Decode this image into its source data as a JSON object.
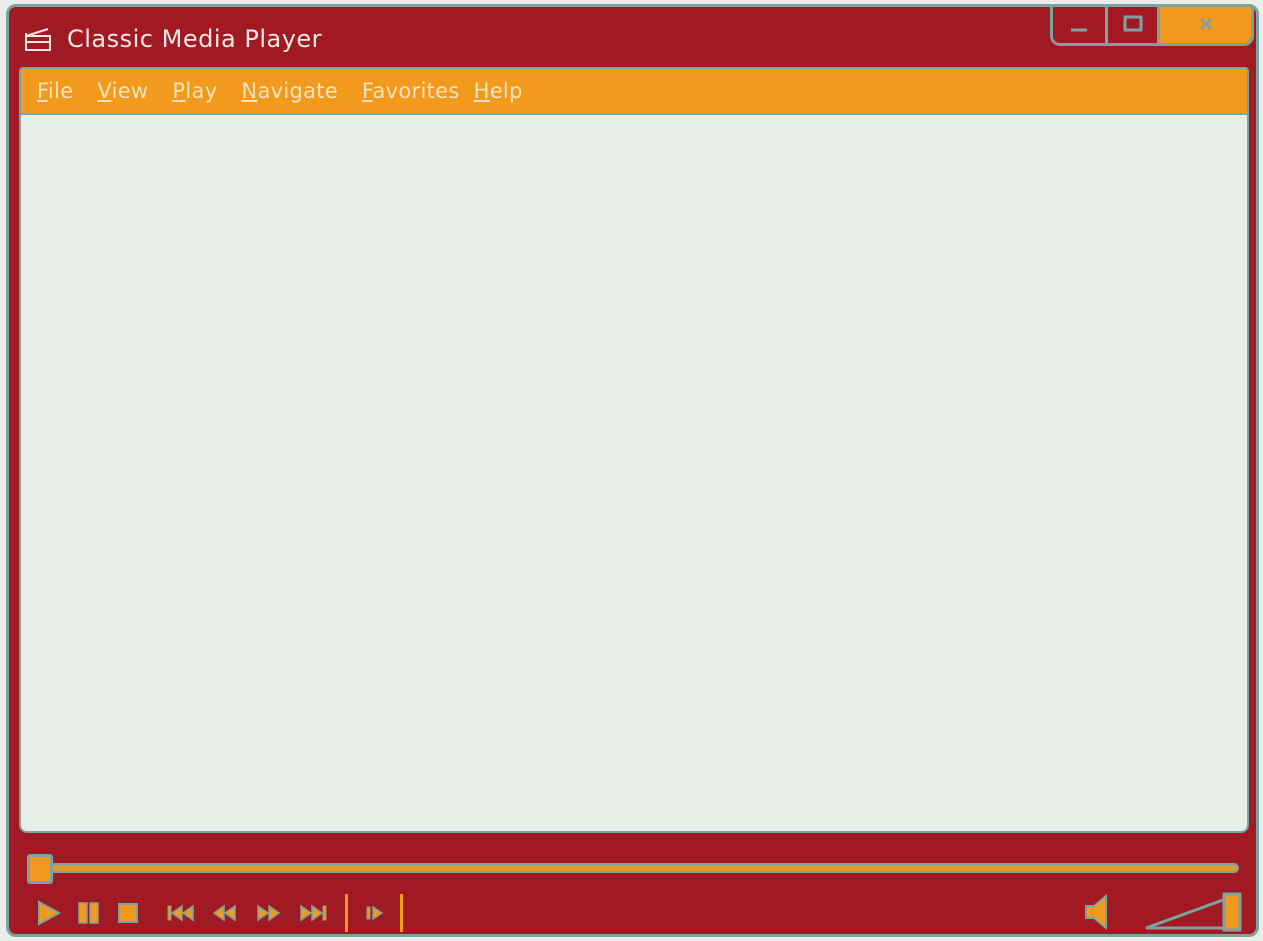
{
  "window": {
    "title": "Classic Media Player",
    "icon": "clapperboard-icon",
    "controls": {
      "minimize": "minimize-icon",
      "maximize": "maximize-icon",
      "close": "close-icon"
    }
  },
  "menu": {
    "items": [
      {
        "accel": "F",
        "rest": "ile"
      },
      {
        "accel": "V",
        "rest": "iew"
      },
      {
        "accel": "P",
        "rest": "lay"
      },
      {
        "accel": "N",
        "rest": "avigate"
      },
      {
        "accel": "F",
        "rest": "avorites"
      },
      {
        "accel": "H",
        "rest": "elp"
      }
    ]
  },
  "playback": {
    "progress": 0.0,
    "volume": 1.0,
    "buttons": [
      "play-icon",
      "pause-icon",
      "stop-icon",
      "skip-back-icon",
      "rewind-icon",
      "fast-forward-icon",
      "skip-forward-icon",
      "frame-step-icon"
    ]
  },
  "colors": {
    "frame": "#a11a23",
    "accent": "#f19a1d",
    "outline": "#7aa3a1",
    "screen": "#e8eee7"
  }
}
